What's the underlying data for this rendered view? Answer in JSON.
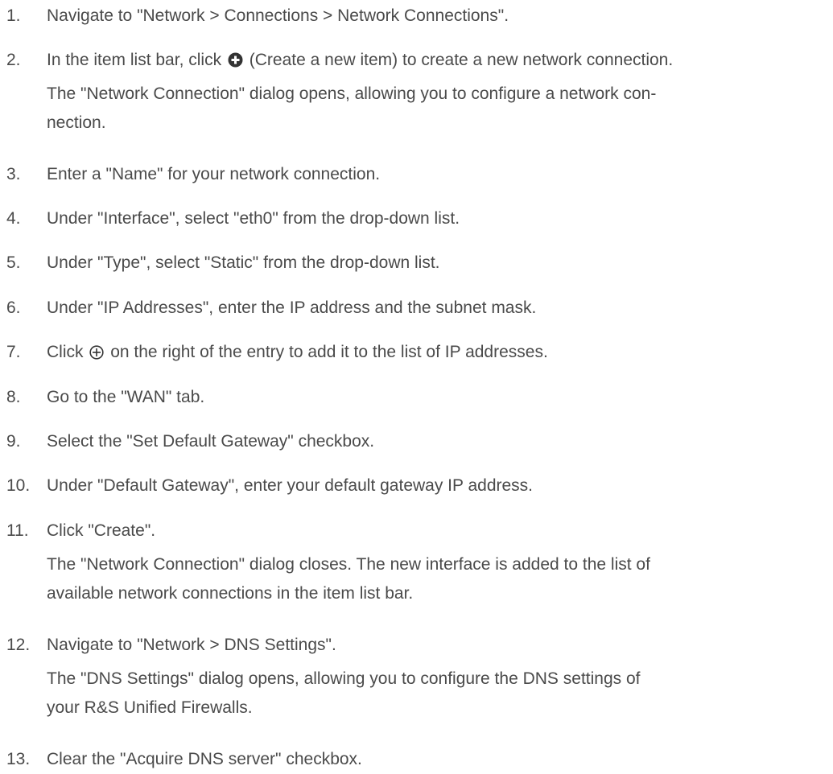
{
  "steps": [
    {
      "num": "1.",
      "text": "Navigate to \"Network > Connections > Network Connections\"."
    },
    {
      "num": "2.",
      "before_icon": "In the item list bar, click",
      "icon": "plus-circle-filled-icon",
      "after_icon": "(Create a new item) to create a new network connection."
    },
    {
      "result": "The \"Network Connection\" dialog opens, allowing you to configure a network con-\nnection."
    },
    {
      "num": "3.",
      "text": "Enter a \"Name\" for your network connection."
    },
    {
      "num": "4.",
      "text": "Under \"Interface\", select \"eth0\" from the drop-down list."
    },
    {
      "num": "5.",
      "text": "Under \"Type\", select \"Static\" from the drop-down list."
    },
    {
      "num": "6.",
      "text": "Under \"IP Addresses\", enter the IP address and the subnet mask."
    },
    {
      "num": "7.",
      "before_icon": "Click",
      "icon": "plus-circle-outline-icon",
      "after_icon": "on the right of the entry to add it to the list of IP addresses."
    },
    {
      "num": "8.",
      "text": "Go to the \"WAN\" tab."
    },
    {
      "num": "9.",
      "text": "Select the \"Set Default Gateway\" checkbox."
    },
    {
      "num": "10.",
      "text": "Under \"Default Gateway\", enter your default gateway IP address."
    },
    {
      "num": "11.",
      "text": "Click \"Create\"."
    },
    {
      "result": "The \"Network Connection\" dialog closes. The new interface is added to the list of\navailable network connections in the item list bar."
    },
    {
      "num": "12.",
      "text": "Navigate to \"Network > DNS Settings\"."
    },
    {
      "result": "The \"DNS Settings\" dialog opens, allowing you to configure the DNS settings of\nyour R&S Unified Firewalls."
    },
    {
      "num": "13.",
      "text": "Clear the \"Acquire DNS server\" checkbox."
    }
  ]
}
